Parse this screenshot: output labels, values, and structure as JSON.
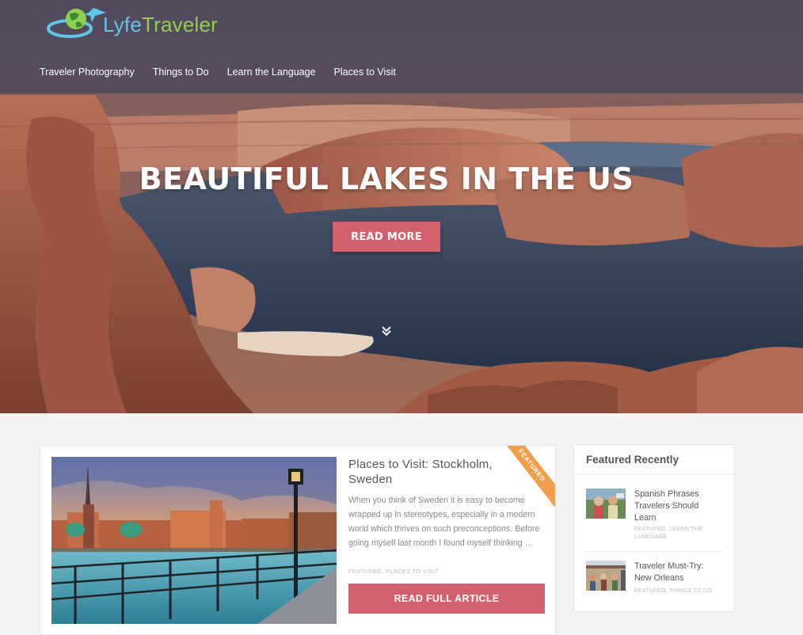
{
  "brand": {
    "logo_part1": "Lyfe",
    "logo_part2": "Traveler",
    "logo_icon": "globe-plane-icon"
  },
  "nav": [
    {
      "label": "Traveler Photography"
    },
    {
      "label": "Things to Do"
    },
    {
      "label": "Learn the Language"
    },
    {
      "label": "Places to Visit"
    }
  ],
  "hero": {
    "title": "BEAUTIFUL LAKES IN THE US",
    "button": "READ MORE",
    "scroll_icon": "double-chevron-down-icon"
  },
  "featured_post": {
    "title": "Places to Visit: Stockholm, Sweden",
    "excerpt": "When you think of Sweden it is easy to become wrapped up in stereotypes, especially in a modern world which thrives on such preconceptions. Before going myself last month I found myself thinking …",
    "categories": "FEATURED, PLACES TO VISIT",
    "button": "READ FULL ARTICLE",
    "ribbon": "FEATURED"
  },
  "sidebar": {
    "heading": "Featured Recently",
    "items": [
      {
        "title": "Spanish Phrases Travelers Should Learn",
        "categories": "FEATURED, LEARN THE LANGUAGE"
      },
      {
        "title": "Traveler Must-Try: New Orleans",
        "categories": "FEATURED, THINGS TO DO"
      }
    ]
  },
  "colors": {
    "accent": "#d2606d",
    "ribbon": "#f0a04b",
    "logo_blue": "#5ec6e8",
    "logo_green": "#8fd14f"
  }
}
